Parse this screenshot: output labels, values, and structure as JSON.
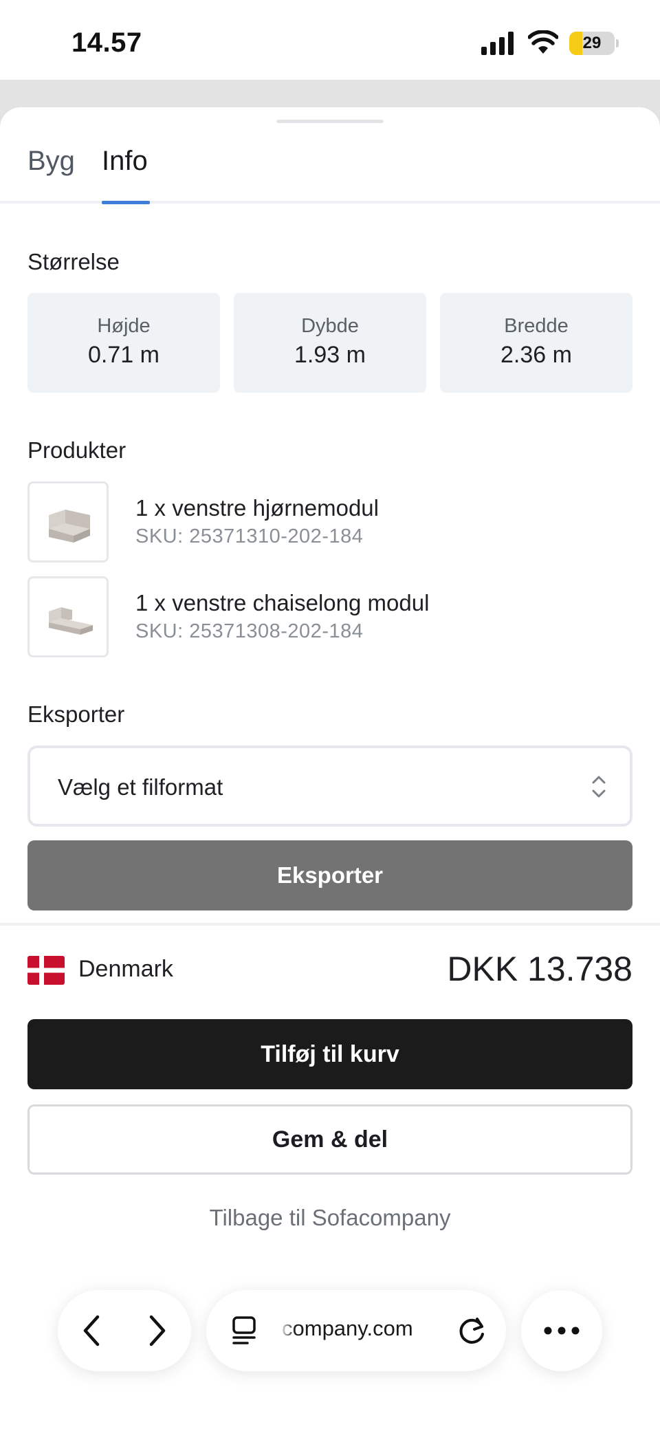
{
  "status_bar": {
    "time": "14.57",
    "battery_level": "29",
    "battery_fraction": 0.29
  },
  "tabs": [
    {
      "label": "Byg",
      "active": false
    },
    {
      "label": "Info",
      "active": true
    }
  ],
  "size": {
    "title": "Størrelse",
    "items": [
      {
        "label": "Højde",
        "value": "0.71 m"
      },
      {
        "label": "Dybde",
        "value": "1.93 m"
      },
      {
        "label": "Bredde",
        "value": "2.36 m"
      }
    ]
  },
  "products": {
    "title": "Produkter",
    "items": [
      {
        "name": "1 x venstre hjørnemodul",
        "sku": "SKU: 25371310-202-184"
      },
      {
        "name": "1 x venstre chaiselong modul",
        "sku": "SKU: 25371308-202-184"
      }
    ]
  },
  "export": {
    "title": "Eksporter",
    "select_placeholder": "Vælg et filformat",
    "button_label": "Eksporter"
  },
  "footer": {
    "country": "Denmark",
    "price": "DKK 13.738",
    "cart_button": "Tilføj til kurv",
    "save_button": "Gem & del",
    "back_link": "Tilbage til Sofacompany"
  },
  "browser": {
    "url": "company.com"
  },
  "colors": {
    "accent": "#3f7ed8",
    "card_bg": "#eff3f5",
    "export_button": "#737373",
    "primary_button": "#1b1b1b",
    "flag_red": "#c8102e",
    "battery_yellow": "#f7cc16"
  },
  "icons": [
    "signal-icon",
    "wifi-icon",
    "battery-icon",
    "sofa-thumbnail",
    "chevron-up-down-icon",
    "denmark-flag-icon",
    "back-arrow-icon",
    "forward-arrow-icon",
    "tabs-icon",
    "reload-icon",
    "more-icon"
  ]
}
